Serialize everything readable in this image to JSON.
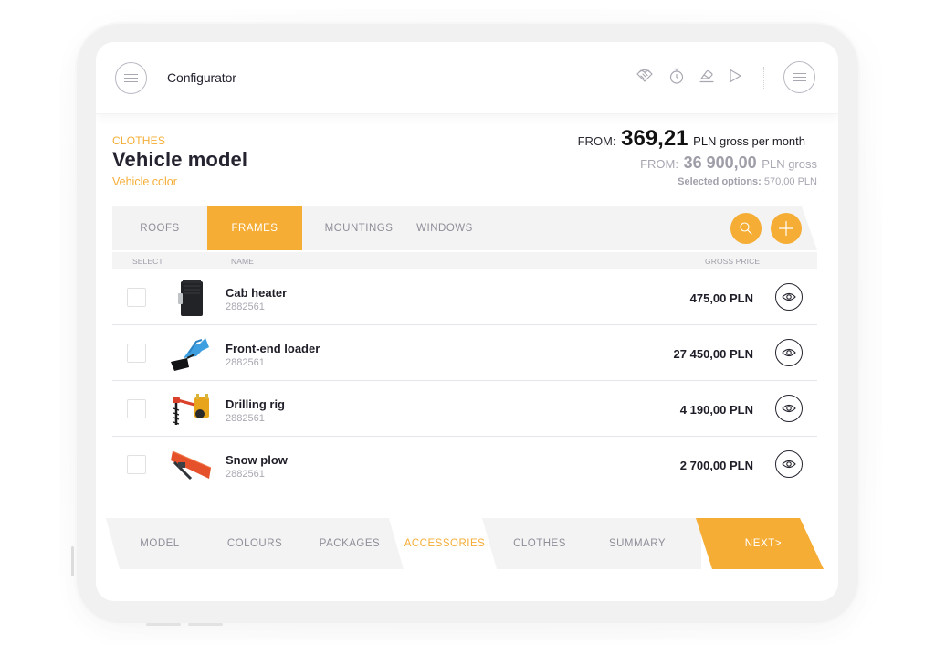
{
  "header": {
    "title": "Configurator",
    "icons": [
      "menu-icon",
      "handshake-icon",
      "timer-icon",
      "eraser-icon",
      "play-icon",
      "menu-icon"
    ]
  },
  "hero": {
    "crumb": "CLOTHES",
    "title": "Vehicle model",
    "subtitle": "Vehicle color",
    "monthly_from_label": "FROM:",
    "monthly_value": "369,21",
    "monthly_suffix": "PLN gross per month",
    "gross_from_label": "FROM:",
    "gross_value": "36 900,00",
    "gross_suffix": "PLN gross",
    "selected_label": "Selected options:",
    "selected_value": "570,00 PLN"
  },
  "category_tabs": [
    {
      "label": "ROOFS",
      "active": false
    },
    {
      "label": "FRAMES",
      "active": true
    },
    {
      "label": "MOUNTINGS",
      "active": false
    },
    {
      "label": "WINDOWS",
      "active": false
    }
  ],
  "actions": {
    "search_icon": "search-icon",
    "add_icon": "plus-icon"
  },
  "table": {
    "columns": [
      "SELECT",
      "NAME",
      "GROSS PRICE"
    ],
    "rows": [
      {
        "name": "Cab heater",
        "code": "2882561",
        "price": "475,00 PLN",
        "checked": false
      },
      {
        "name": "Front-end loader",
        "code": "2882561",
        "price": "27 450,00 PLN",
        "checked": false
      },
      {
        "name": "Drilling rig",
        "code": "2882561",
        "price": "4 190,00 PLN",
        "checked": false
      },
      {
        "name": "Snow plow",
        "code": "2882561",
        "price": "2 700,00 PLN",
        "checked": false
      }
    ]
  },
  "steps": {
    "items": [
      {
        "label": "MODEL",
        "active": false
      },
      {
        "label": "COLOURS",
        "active": false
      },
      {
        "label": "PACKAGES",
        "active": false
      },
      {
        "label": "ACCESSORIES",
        "active": true
      },
      {
        "label": "CLOTHES",
        "active": false
      },
      {
        "label": "SUMMARY",
        "active": false
      }
    ],
    "next_label": "NEXT>"
  },
  "colors": {
    "accent": "#f5ad35",
    "text_dark": "#24232f",
    "text_muted": "#8f8e99",
    "tab_bg": "#f3f3f3"
  }
}
